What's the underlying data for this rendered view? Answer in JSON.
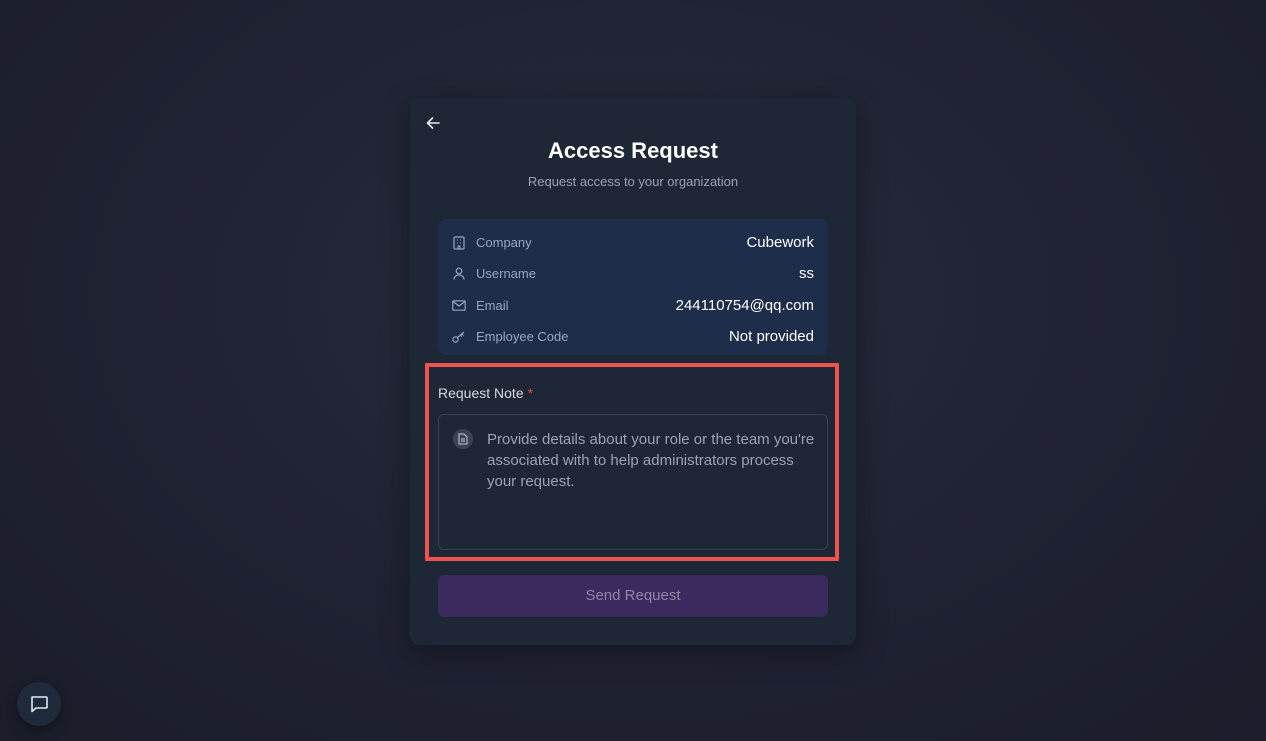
{
  "header": {
    "back_icon": "arrow-left-icon",
    "title": "Access Request",
    "subtitle": "Request access to your organization"
  },
  "info": {
    "rows": [
      {
        "icon": "building-icon",
        "label": "Company",
        "value": "Cubework"
      },
      {
        "icon": "user-icon",
        "label": "Username",
        "value": "ss"
      },
      {
        "icon": "mail-icon",
        "label": "Email",
        "value": "244110754@qq.com"
      },
      {
        "icon": "key-icon",
        "label": "Employee Code",
        "value": "Not provided"
      }
    ]
  },
  "note": {
    "label": "Request Note",
    "required_mark": "*",
    "placeholder": "Provide details about your role or the team you're associated with to help administrators process your request.",
    "icon": "document-icon"
  },
  "actions": {
    "send_label": "Send Request"
  },
  "chat": {
    "icon": "message-square-icon"
  },
  "colors": {
    "card_bg": "#1e2736",
    "info_bg": "#1e2d4a",
    "button_bg": "#3b2a5e",
    "highlight": "#ef5350",
    "required": "#ef4444"
  }
}
